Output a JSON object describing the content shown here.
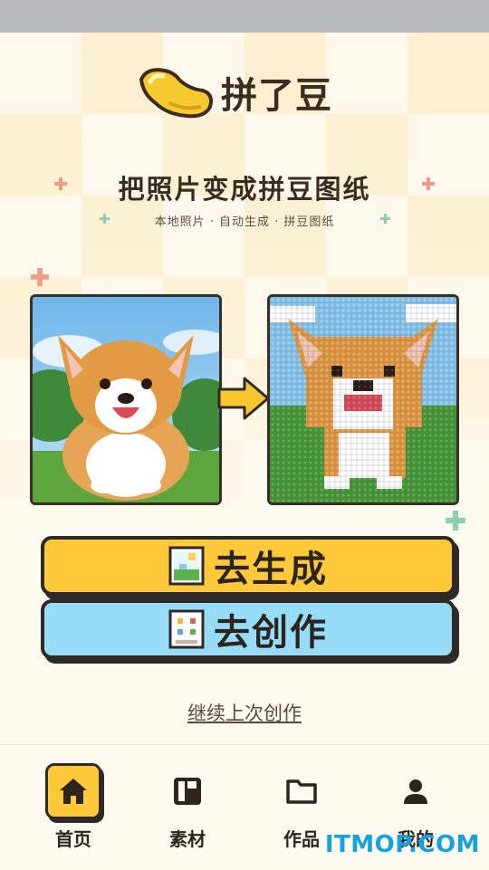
{
  "app": {
    "name": "拼了豆"
  },
  "hero": {
    "headline": "把照片变成拼豆图纸",
    "subtitle": "本地照片 · 自动生成 · 拼豆图纸"
  },
  "preview": {
    "source_image": "corgi-photo",
    "result_image": "corgi-bead-pattern"
  },
  "actions": {
    "generate_label": "去生成",
    "create_label": "去创作",
    "continue_label": "继续上次创作"
  },
  "tabbar": {
    "items": [
      {
        "label": "首页",
        "icon": "home-icon",
        "active": true
      },
      {
        "label": "素材",
        "icon": "material-icon",
        "active": false
      },
      {
        "label": "作品",
        "icon": "folder-icon",
        "active": false
      },
      {
        "label": "我的",
        "icon": "person-icon",
        "active": false
      }
    ]
  },
  "watermark": "ITMOP.COM",
  "colors": {
    "accent_yellow": "#ffc93a",
    "accent_blue": "#97ddf7",
    "outline": "#2f2a27"
  }
}
